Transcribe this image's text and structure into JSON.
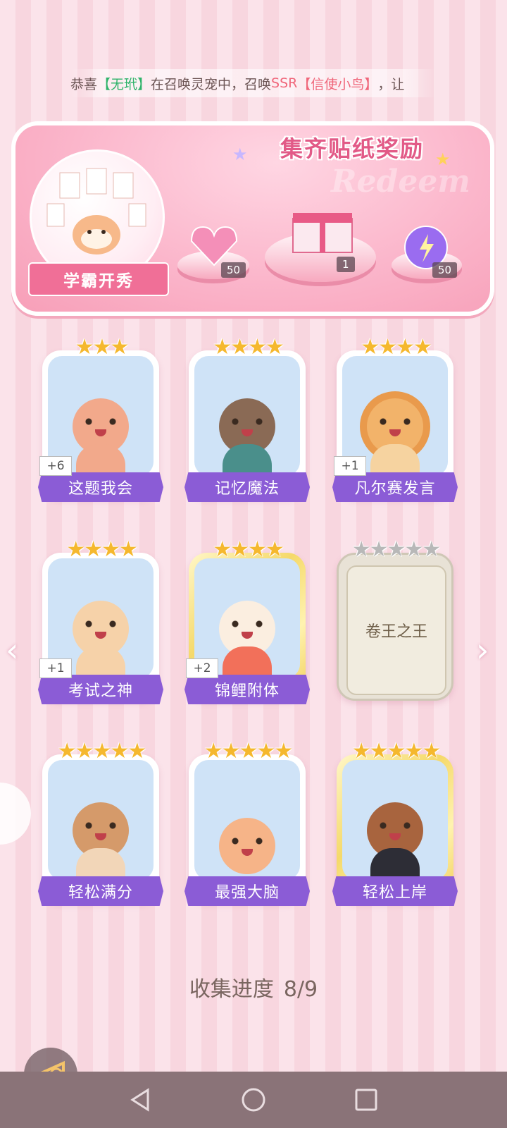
{
  "ticker": {
    "prefix": "恭喜",
    "player": "【无玳】",
    "middle": "在召唤灵宠中，召唤",
    "rarity": "SSR",
    "pet": "【信使小鸟】",
    "suffix": "，让"
  },
  "reward": {
    "title": "集齐贴纸奖励",
    "watermark": "Redeem",
    "badge_label": "学霸开秀",
    "items": [
      {
        "icon": "pink-heart-gem-icon",
        "qty": "50"
      },
      {
        "icon": "gift-box-icon",
        "qty": "1"
      },
      {
        "icon": "purple-orb-icon",
        "qty": "50"
      }
    ]
  },
  "stickers": [
    {
      "name": "这题我会",
      "stars": "★★★",
      "bonus": "+6",
      "color": "#f2a98b"
    },
    {
      "name": "记忆魔法",
      "stars": "★★★★",
      "bonus": "",
      "color": "#8a6a55"
    },
    {
      "name": "凡尔赛发言",
      "stars": "★★★★",
      "bonus": "+1",
      "color": "#f2b36a"
    },
    {
      "name": "考试之神",
      "stars": "★★★★",
      "bonus": "+1",
      "color": "#f6d2a9"
    },
    {
      "name": "锦鲤附体",
      "stars": "★★★★",
      "bonus": "+2",
      "color": "#fbeee0"
    },
    {
      "name": "卷王之王",
      "stars": "★★★★★",
      "bonus": "",
      "color": "#e8e2d6"
    },
    {
      "name": "轻松满分",
      "stars": "★★★★★",
      "bonus": "",
      "color": "#d59a6a"
    },
    {
      "name": "最强大脑",
      "stars": "★★★★★",
      "bonus": "",
      "color": "#f6b488"
    },
    {
      "name": "轻松上岸",
      "stars": "★★★★★",
      "bonus": "",
      "color": "#a8643e"
    }
  ],
  "progress": {
    "label": "收集进度",
    "value": "8/9"
  },
  "nav": {
    "back": "back-icon",
    "home": "home-icon",
    "recents": "recents-icon"
  }
}
